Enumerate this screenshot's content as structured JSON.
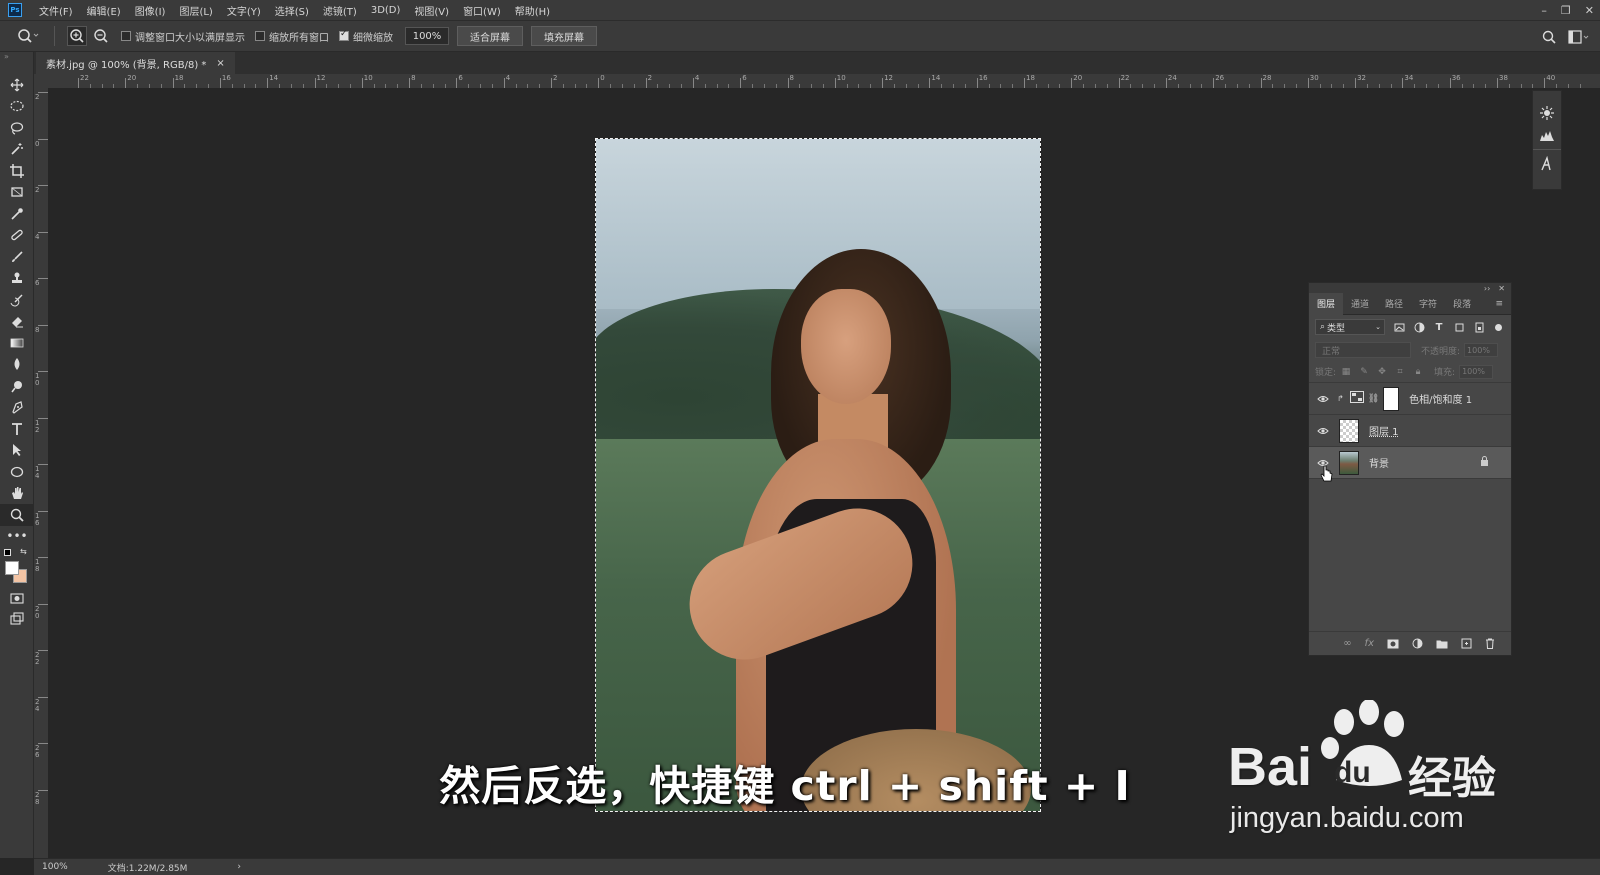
{
  "app": {
    "logo": "Ps",
    "menu": [
      "文件(F)",
      "编辑(E)",
      "图像(I)",
      "图层(L)",
      "文字(Y)",
      "选择(S)",
      "滤镜(T)",
      "3D(D)",
      "视图(V)",
      "窗口(W)",
      "帮助(H)"
    ]
  },
  "options": {
    "resize_windows": "调整窗口大小以满屏显示",
    "zoom_all_windows": "缩放所有窗口",
    "scrubby_zoom": "细微缩放",
    "zoom_value": "100%",
    "fit_screen": "适合屏幕",
    "fill_screen": "填充屏幕",
    "checkboxes": {
      "resize_windows": false,
      "zoom_all_windows": false,
      "scrubby_zoom": true
    }
  },
  "document": {
    "tab_title": "素材.jpg @ 100% (背景, RGB/8) *",
    "close": "×"
  },
  "rulers": {
    "h_labels": [
      "22",
      "20",
      "18",
      "16",
      "14",
      "12",
      "10",
      "8",
      "6",
      "4",
      "2",
      "0",
      "2",
      "4",
      "6",
      "8",
      "10",
      "12",
      "14",
      "16",
      "18",
      "20",
      "22",
      "24",
      "26",
      "28",
      "30",
      "32",
      "34",
      "36",
      "38",
      "40"
    ],
    "v_labels": [
      "2",
      "0",
      "2",
      "4",
      "6",
      "8",
      "1 0",
      "1 2",
      "1 4",
      "1 6",
      "1 8",
      "2 0",
      "2 2",
      "2 4",
      "2 6",
      "2 8"
    ]
  },
  "layers_panel": {
    "tabs": [
      "图层",
      "通道",
      "路径",
      "字符",
      "段落"
    ],
    "filter_kind": "类型",
    "blend_mode": "正常",
    "opacity_label": "不透明度:",
    "opacity_value": "100%",
    "lock_label": "锁定:",
    "fill_label": "填充:",
    "fill_value": "100%",
    "layers": [
      {
        "name": "色相/饱和度 1",
        "visible": true,
        "type": "adjustment"
      },
      {
        "name": "图层 1",
        "visible": true,
        "type": "transparent"
      },
      {
        "name": "背景",
        "visible": true,
        "type": "photo",
        "locked": true,
        "selected": true
      }
    ]
  },
  "status": {
    "zoom": "100%",
    "doc_size": "文档:1.22M/2.85M",
    "arrow": "›"
  },
  "overlay": {
    "subtitle": "然后反选，快捷键 ctrl + shift + I",
    "watermark_brand": "Bai",
    "watermark_du": "du",
    "watermark_jy": "经验",
    "watermark_url": "jingyan.baidu.com"
  },
  "colors": {
    "accent": "#31a8ff",
    "panel": "#474747",
    "chrome": "#3a3a3a",
    "canvas": "#262626",
    "foreground_swatch": "#ffffff",
    "background_swatch": "#f3c4a4"
  },
  "icons": {
    "toolbar": [
      "move-icon",
      "marquee-icon",
      "lasso-icon",
      "magic-wand-icon",
      "crop-icon",
      "frame-icon",
      "eyedropper-icon",
      "brush-icon",
      "stamp-icon",
      "history-brush-icon",
      "eraser-icon",
      "gradient-icon",
      "blur-icon",
      "dodge-icon",
      "pen-icon",
      "type-icon",
      "path-select-icon",
      "ellipse-icon",
      "hand-icon",
      "zoom-icon",
      "more-icon"
    ]
  }
}
